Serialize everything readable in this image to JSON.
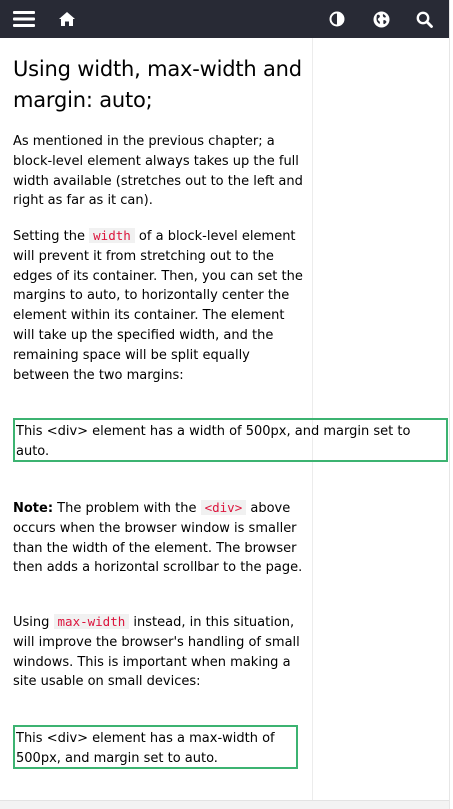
{
  "topbar": {
    "menu_icon": "hamburger-menu-icon",
    "home_icon": "home-icon",
    "theme_icon": "contrast-icon",
    "globe_icon": "globe-icon",
    "search_icon": "search-icon",
    "background": "#282a35"
  },
  "article": {
    "heading": "Using width, max-width and margin: auto;",
    "p1": "As mentioned in the previous chapter; a block-level element always takes up the full width available (stretches out to the left and right as far as it can).",
    "p2_before": "Setting the ",
    "p2_code": "width",
    "p2_after": " of a block-level element will prevent it from stretching out to the edges of its container. Then, you can set the margins to auto, to horizontally center the element within its container. The element will take up the specified width, and the remaining space will be split equally between the two margins:",
    "demo1": "This <div> element has a width of 500px, and margin set to auto.",
    "note_label": "Note:",
    "p3_before": " The problem with the ",
    "p3_code": "<div>",
    "p3_after": " above occurs when the browser window is smaller than the width of the element. The browser then adds a horizontal scrollbar to the page.",
    "p4_before": "Using ",
    "p4_code": "max-width",
    "p4_after": " instead, in this situation, will improve the browser's handling of small windows. This is important when making a site usable on small devices:",
    "demo2": "This <div> element has a max-width of 500px, and margin set to auto."
  },
  "colors": {
    "code_text": "#dc143c",
    "code_bg": "#f1f1f1",
    "demo_border": "#3cb371"
  }
}
